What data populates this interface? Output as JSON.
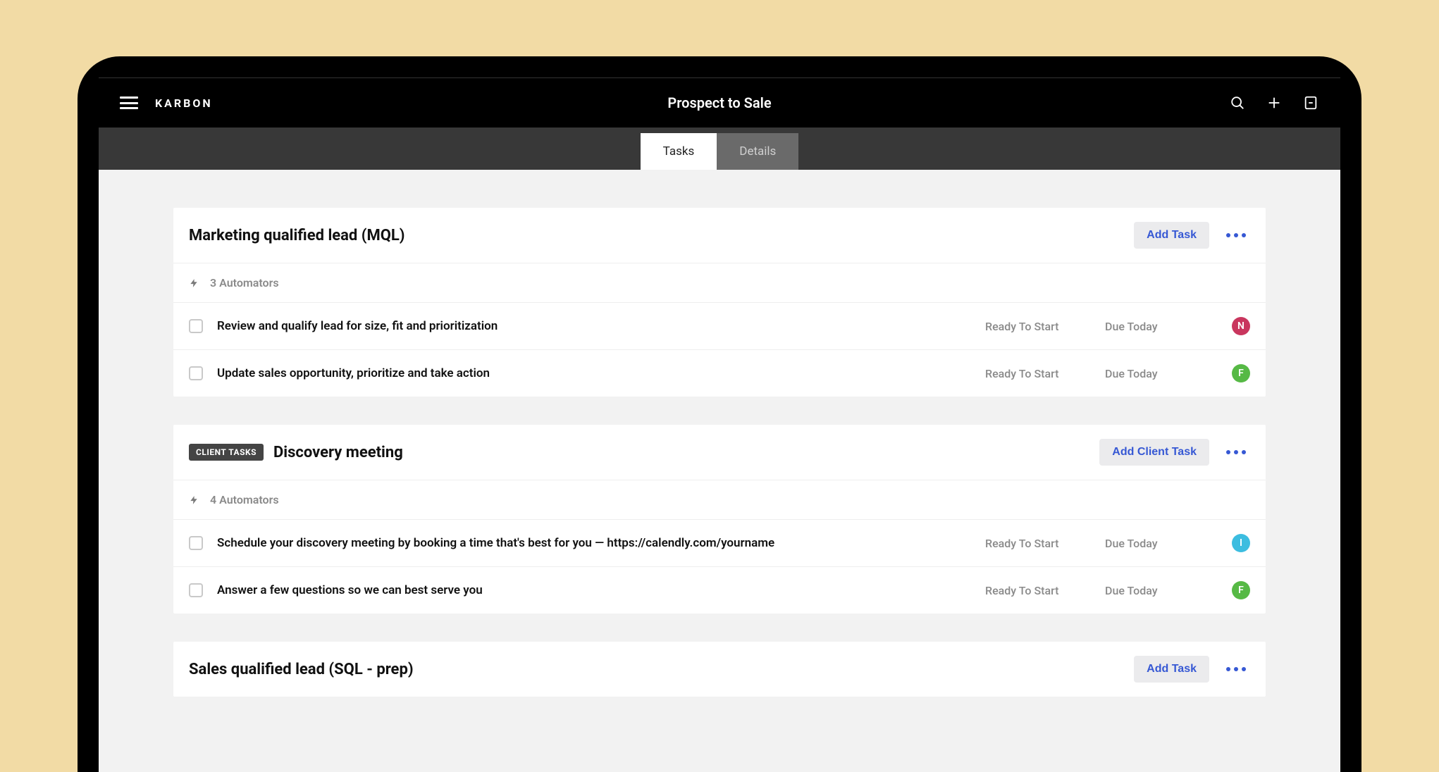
{
  "brand": "KARBON",
  "title": "Prospect to Sale",
  "tabs": [
    "Tasks",
    "Details"
  ],
  "activeTab": 0,
  "sections": [
    {
      "title": "Marketing qualified lead (MQL)",
      "clientBadge": null,
      "addLabel": "Add Task",
      "automators": "3 Automators",
      "tasks": [
        {
          "title": "Review and qualify lead for size, fit and prioritization",
          "status": "Ready To Start",
          "due": "Due Today",
          "avatar": "N",
          "avatarClass": "avatar-N"
        },
        {
          "title": "Update sales opportunity, prioritize and take action",
          "status": "Ready To Start",
          "due": "Due Today",
          "avatar": "F",
          "avatarClass": "avatar-F"
        }
      ]
    },
    {
      "title": "Discovery meeting",
      "clientBadge": "CLIENT TASKS",
      "addLabel": "Add Client Task",
      "automators": "4 Automators",
      "tasks": [
        {
          "title": "Schedule your discovery meeting by booking a time that's best for you — https://calendly.com/yourname",
          "status": "Ready To Start",
          "due": "Due Today",
          "avatar": "I",
          "avatarClass": "avatar-I"
        },
        {
          "title": "Answer a few questions so we can best serve you",
          "status": "Ready To Start",
          "due": "Due Today",
          "avatar": "F",
          "avatarClass": "avatar-F"
        }
      ]
    },
    {
      "title": "Sales qualified lead (SQL - prep)",
      "clientBadge": null,
      "addLabel": "Add Task",
      "automators": null,
      "tasks": []
    }
  ]
}
